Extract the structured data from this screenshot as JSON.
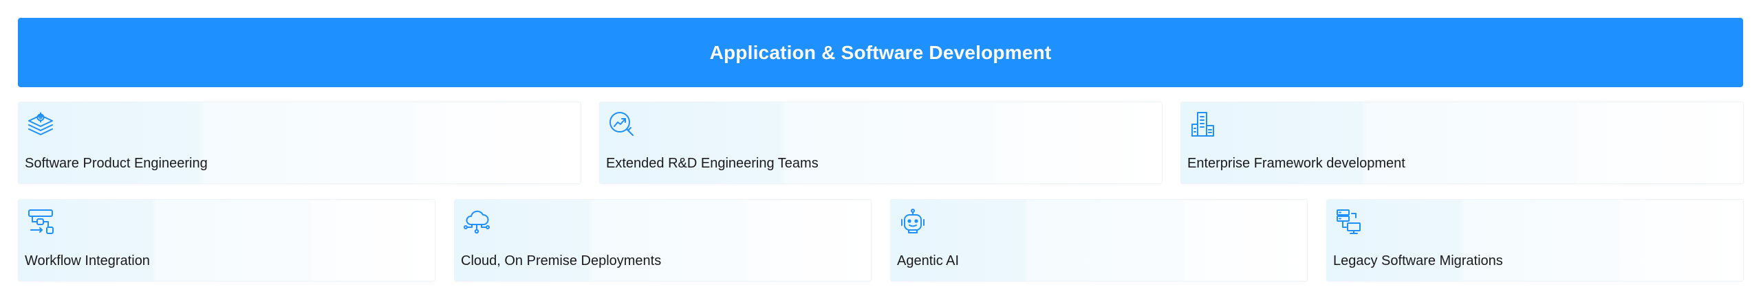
{
  "header": {
    "title": "Application & Software Development"
  },
  "accent_color": "#1e90ff",
  "services": [
    {
      "label": "Software Product Engineering",
      "icon": "layers-gear-icon"
    },
    {
      "label": "Extended R&D Engineering Teams",
      "icon": "magnifier-trend-icon"
    },
    {
      "label": "Enterprise Framework development",
      "icon": "buildings-icon"
    },
    {
      "label": "Workflow Integration",
      "icon": "workflow-icon"
    },
    {
      "label": "Cloud, On Premise Deployments",
      "icon": "cloud-network-icon"
    },
    {
      "label": "Agentic AI",
      "icon": "robot-icon"
    },
    {
      "label": "Legacy Software Migrations",
      "icon": "server-migration-icon"
    }
  ]
}
